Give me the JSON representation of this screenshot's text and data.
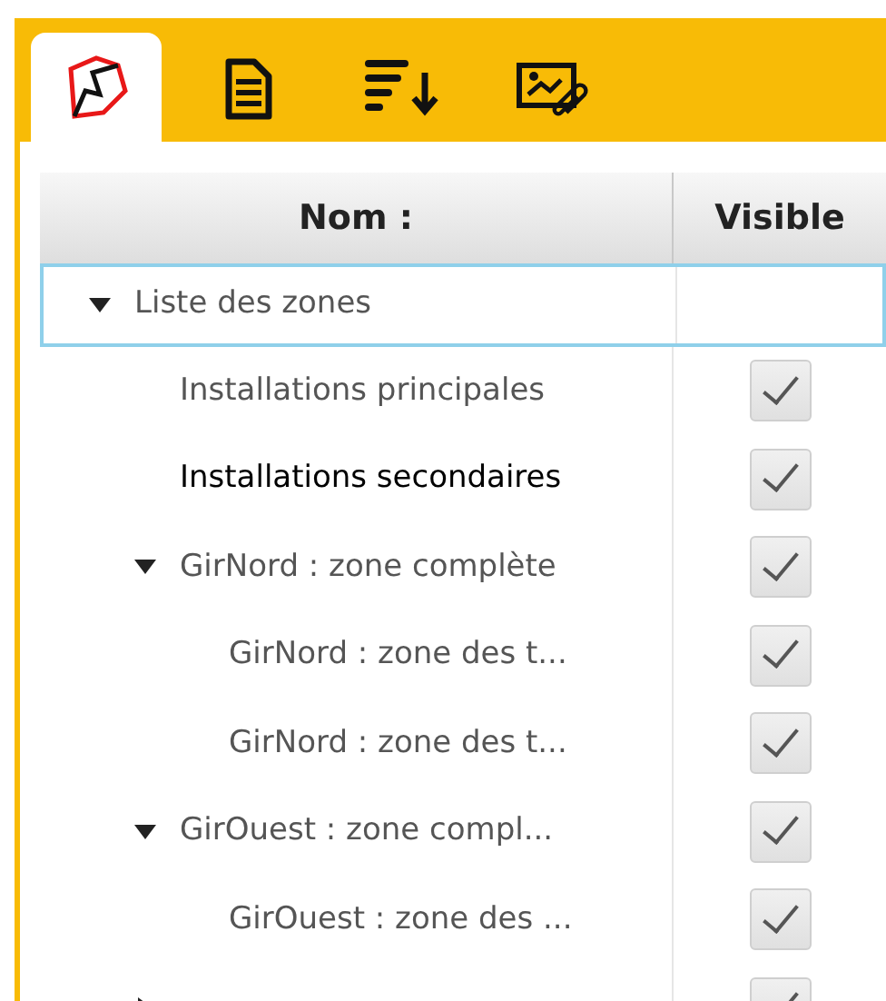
{
  "tabs": [
    {
      "kind": "zones",
      "selected": true
    },
    {
      "kind": "document",
      "selected": false
    },
    {
      "kind": "sort",
      "selected": false
    },
    {
      "kind": "image",
      "selected": false
    }
  ],
  "columns": [
    "Nom :",
    "Visible"
  ],
  "tree": {
    "label": "Liste des zones",
    "expanded": true,
    "selected": true,
    "children": [
      {
        "label": "Installations principales",
        "checked": true,
        "highlighted": false
      },
      {
        "label": "Installations secondaires",
        "checked": true,
        "highlighted": true
      },
      {
        "label": "GirNord : zone complète",
        "checked": true,
        "highlighted": false,
        "expanded": true,
        "children": [
          {
            "label": "GirNord : zone des t...",
            "checked": true,
            "highlighted": false
          },
          {
            "label": "GirNord : zone des t...",
            "checked": true,
            "highlighted": false
          }
        ]
      },
      {
        "label": "GirOuest : zone compl...",
        "checked": true,
        "highlighted": false,
        "expanded": true,
        "children": [
          {
            "label": "GirOuest : zone des ...",
            "checked": true,
            "highlighted": false
          }
        ]
      },
      {
        "checked": true,
        "expanded": false
      }
    ]
  }
}
